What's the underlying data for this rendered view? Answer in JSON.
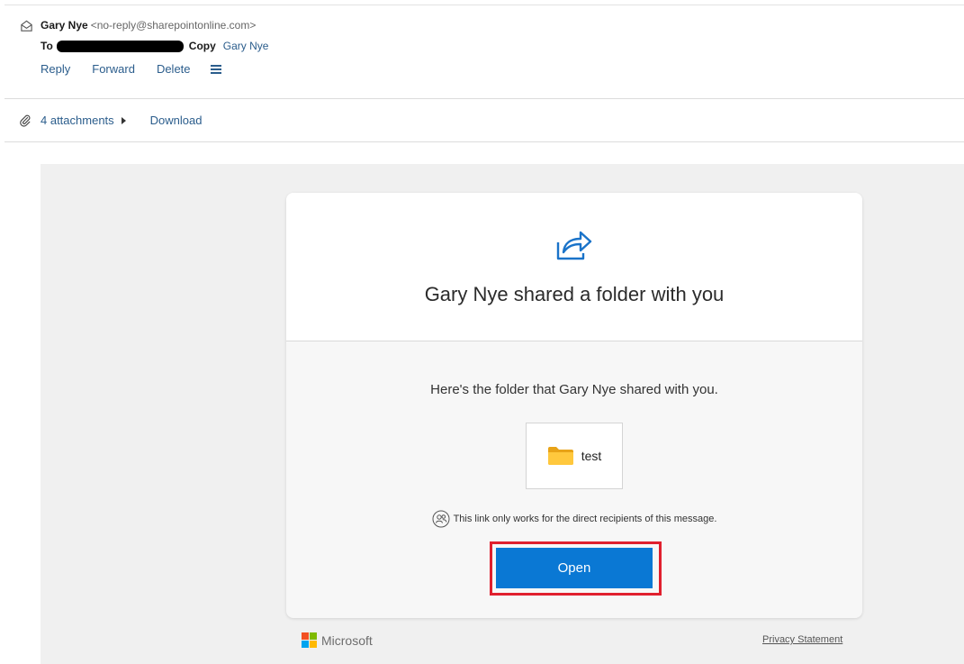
{
  "email": {
    "sender_name": "Gary Nye",
    "sender_email": "<no-reply@sharepointonline.com>",
    "to_label": "To",
    "copy_label": "Copy",
    "copy_name": "Gary Nye",
    "actions": {
      "reply": "Reply",
      "forward": "Forward",
      "delete": "Delete"
    },
    "attachments_label": "4 attachments",
    "download_label": "Download"
  },
  "message": {
    "title": "Gary Nye shared a folder with you",
    "subtitle": "Here's the folder that Gary Nye shared with you.",
    "folder_name": "test",
    "notice": "This link only works for the direct recipients of this message.",
    "open_label": "Open",
    "brand": "Microsoft",
    "privacy": "Privacy Statement"
  },
  "colors": {
    "link": "#2b5d8c",
    "button": "#0a78d4",
    "highlight": "#e0202e",
    "folder": "#ffc83d"
  },
  "icons": {
    "envelope": "envelope-open-icon",
    "paperclip": "paperclip-icon",
    "menu": "hamburger-menu-icon",
    "share": "share-arrow-icon",
    "folder": "folder-icon",
    "people": "people-icon",
    "logo": "microsoft-logo-icon"
  }
}
